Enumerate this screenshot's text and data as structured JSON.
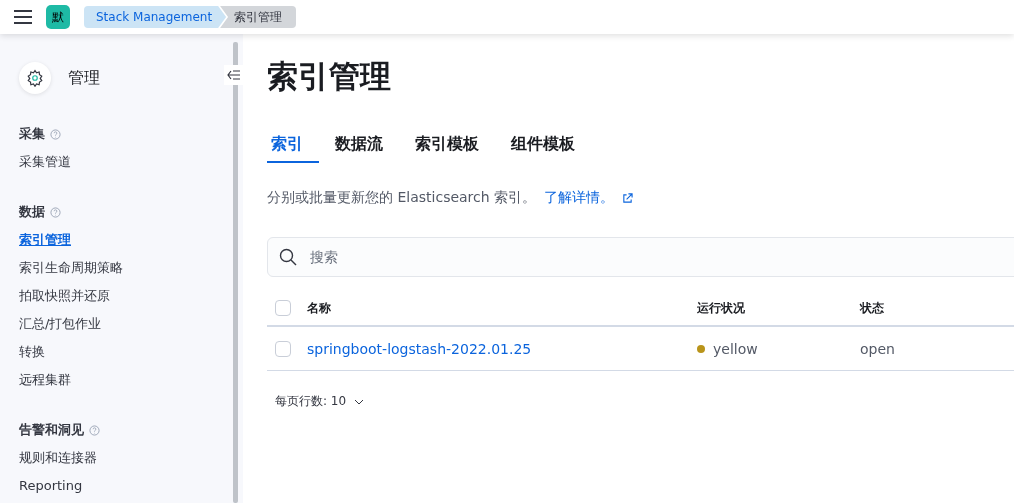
{
  "header": {
    "avatar": "默",
    "breadcrumbs": [
      {
        "label": "Stack Management",
        "selected": false
      },
      {
        "label": "索引管理",
        "selected": true
      }
    ]
  },
  "sidebar": {
    "title": "管理",
    "groups": [
      {
        "title": "采集",
        "items": [
          {
            "label": "采集管道",
            "selected": false
          }
        ]
      },
      {
        "title": "数据",
        "items": [
          {
            "label": "索引管理",
            "selected": true
          },
          {
            "label": "索引生命周期策略",
            "selected": false
          },
          {
            "label": "拍取快照并还原",
            "selected": false
          },
          {
            "label": "汇总/打包作业",
            "selected": false
          },
          {
            "label": "转换",
            "selected": false
          },
          {
            "label": "远程集群",
            "selected": false
          }
        ]
      },
      {
        "title": "告警和洞见",
        "items": [
          {
            "label": "规则和连接器",
            "selected": false
          },
          {
            "label": "Reporting",
            "selected": false
          }
        ]
      }
    ]
  },
  "page": {
    "title": "索引管理",
    "tabs": [
      {
        "label": "索引",
        "selected": true
      },
      {
        "label": "数据流",
        "selected": false
      },
      {
        "label": "索引模板",
        "selected": false
      },
      {
        "label": "组件模板",
        "selected": false
      }
    ],
    "description": "分别或批量更新您的 Elasticsearch 索引。",
    "link": "了解详情。",
    "search": {
      "placeholder": "搜索"
    },
    "table": {
      "columns": [
        "名称",
        "运行状况",
        "状态"
      ],
      "all_checked": false,
      "rows": [
        {
          "checked": false,
          "name": "springboot-logstash-2022.01.25",
          "health": "yellow",
          "color": "#b9941a",
          "status": "open"
        }
      ]
    },
    "rows_per_page": "每页行数: 10"
  }
}
